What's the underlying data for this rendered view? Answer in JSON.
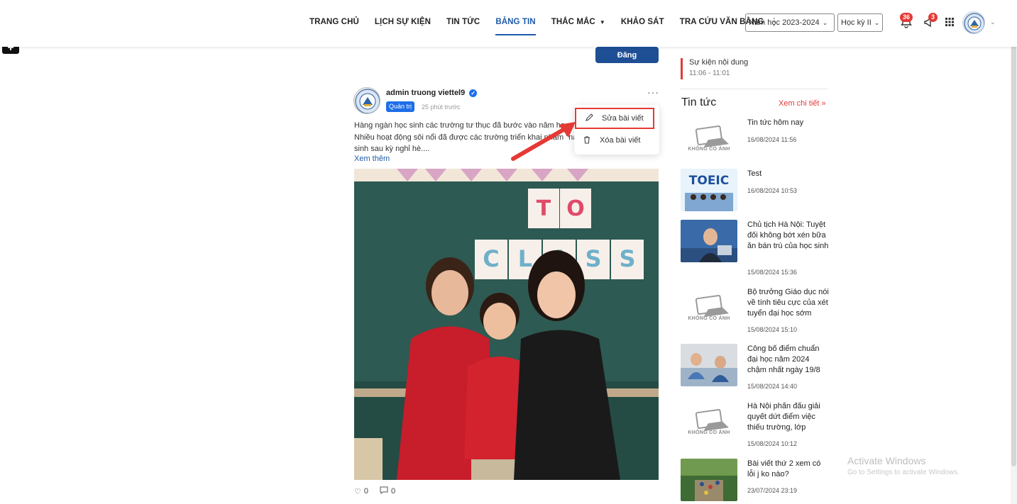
{
  "nav": {
    "items": [
      "TRANG CHỦ",
      "LỊCH SỰ KIỆN",
      "TIN TỨC",
      "BẢNG TIN",
      "THẮC MẮC",
      "KHẢO SÁT",
      "TRA CỨU VĂN BẰNG"
    ],
    "active": "BẢNG TIN",
    "more": "⋮",
    "school_year": "Năm học 2023-2024",
    "semester": "Học kỳ II",
    "notifications_count": "36",
    "alerts_count": "3"
  },
  "post": {
    "submit_label": "Đăng",
    "author": "admin truong viettel9",
    "role": "Quản trị",
    "time_ago": "25 phút trước",
    "text_line1": "Hàng ngàn học sinh các trường tư thục đã bước vào năm học m",
    "text_line2": "Nhiều hoạt động sôi nổi đã được các trường triển khai nhằm \"na",
    "text_line3": "sinh sau kỳ nghỉ hè....",
    "see_more": "Xem thêm",
    "likes": "0",
    "comments": "0",
    "menu": {
      "edit": "Sửa bài viết",
      "delete": "Xóa bài viết"
    },
    "image_letters": [
      "T",
      "O",
      "C",
      "L",
      "A",
      "S",
      "S"
    ]
  },
  "sidebar": {
    "event_title": "Sự kiện nội dung",
    "event_time": "11:06 - 11:01",
    "news_heading": "Tin tức",
    "news_more": "Xem chi tiết »",
    "no_image_label": "KHÔNG CÓ ẢNH",
    "news": [
      {
        "title": "Tin tức hôm nay",
        "date": "16/08/2024 11:56",
        "thumb": "none"
      },
      {
        "title": "Test",
        "date": "16/08/2024 10:53",
        "thumb": "toeic"
      },
      {
        "title": "Chủ tịch Hà Nội: Tuyệt đối không bớt xén bữa ăn bán trú của học sinh",
        "date": "15/08/2024 15:36",
        "thumb": "speaker"
      },
      {
        "title": "Bộ trưởng Giáo dục nói về tính tiêu cực của xét tuyển đại học sớm",
        "date": "15/08/2024 15:10",
        "thumb": "none"
      },
      {
        "title": "Công bố điểm chuẩn đại học năm 2024 chậm nhất ngày 19/8",
        "date": "15/08/2024 14:40",
        "thumb": "exam"
      },
      {
        "title": "Hà Nội phấn đấu giải quyết dứt điểm việc thiếu trường, lớp",
        "date": "15/08/2024 10:12",
        "thumb": "none"
      },
      {
        "title": "Bài viết thứ 2 xem có lỗi j ko nào?",
        "date": "23/07/2024 23:19",
        "thumb": "outdoor"
      }
    ],
    "toeic_text": "TOEIC"
  },
  "watermark": {
    "line1": "Activate Windows",
    "line2": "Go to Settings to activate Windows."
  },
  "colors": {
    "accent": "#1e5aa8",
    "button": "#1e4f95",
    "badge": "#e53935",
    "highlight": "#e53935"
  }
}
